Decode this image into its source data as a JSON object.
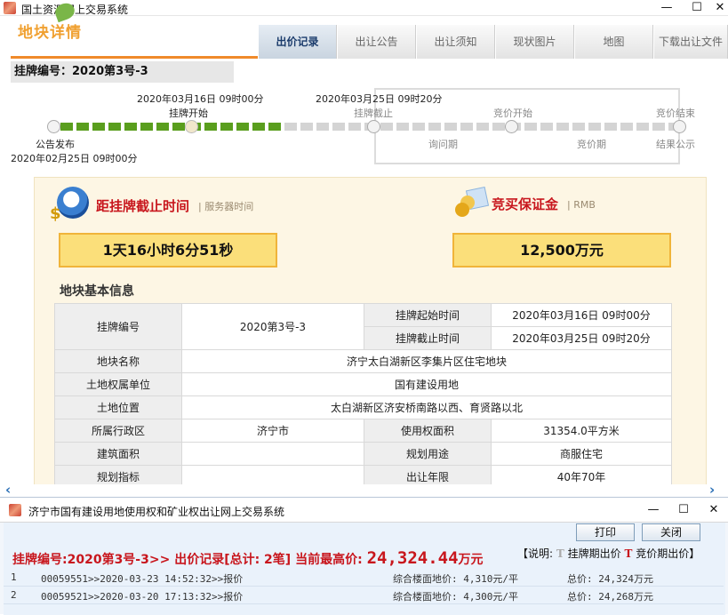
{
  "window": {
    "title": "国土资源网上交易系统",
    "min": "—",
    "max": "☐",
    "close": "✕"
  },
  "header": {
    "logo": "地块详情",
    "tabs": [
      {
        "label": "出价记录",
        "active": true
      },
      {
        "label": "出让公告",
        "active": false
      },
      {
        "label": "出让须知",
        "active": false
      },
      {
        "label": "现状图片",
        "active": false
      },
      {
        "label": "地图",
        "active": false
      },
      {
        "label": "下载出让文件",
        "active": false
      }
    ]
  },
  "lot": {
    "title": "挂牌编号：2020第3号-3"
  },
  "timeline": {
    "announce_label": "公告发布",
    "announce_time": "2020年02月25日  09时00分",
    "listing_start_time": "2020年03月16日  09时00分",
    "listing_start_label": "挂牌开始",
    "listing_end_time": "2020年03月25日  09时20分",
    "listing_end_label": "挂牌截止",
    "inquiry_label": "询问期",
    "bid_start_label": "竞价开始",
    "bid_period_label": "竞价期",
    "bid_end_label": "竞价结束",
    "result_label": "结果公示",
    "colors": {
      "done": "#5a9e1e",
      "pending": "#d4d4d4"
    }
  },
  "deadline": {
    "title": "距挂牌截止时间",
    "sub": "服务器时间",
    "value": "1天16小时6分51秒",
    "icon": "clock-icon"
  },
  "deposit": {
    "title": "竞买保证金",
    "sub": "RMB",
    "value": "12,500万元",
    "icon": "money-icon"
  },
  "info": {
    "title": "地块基本信息",
    "lot_no_label": "挂牌编号",
    "lot_no_value": "2020第3号-3",
    "start_label": "挂牌起始时间",
    "start_value": "2020年03月16日  09时00分",
    "end_label": "挂牌截止时间",
    "end_value": "2020年03月25日  09时20分",
    "name_label": "地块名称",
    "name_value": "济宁太白湖新区李集片区住宅地块",
    "owner_label": "土地权属单位",
    "owner_value": "国有建设用地",
    "location_label": "土地位置",
    "location_value": "太白湖新区济安桥南路以西、育贤路以北",
    "district_label": "所属行政区",
    "district_value": "济宁市",
    "area_label": "使用权面积",
    "area_value": "31354.0平方米",
    "build_label": "建筑面积",
    "build_value": "",
    "use_label": "规划用途",
    "use_value": "商服住宅",
    "plan_label": "规划指标",
    "plan_value": "",
    "years_label": "出让年限",
    "years_value": "40年70年"
  },
  "popup": {
    "title": "济宁市国有建设用地使用权和矿业权出让网上交易系统",
    "print": "打印",
    "close": "关闭",
    "head_prefix": "挂牌编号:2020第3号-3>> 出价记录[总计: 2笔] 当前最高价:",
    "head_price": "24,324.44",
    "head_unit": "万元",
    "legend_prefix": "【说明:",
    "legend_t1": "T",
    "legend_label1": "挂牌期出价",
    "legend_t2": "T",
    "legend_label2": "竞价期出价】",
    "bids": [
      {
        "no": "1",
        "record": "00059551>>2020-03-23 14:52:32>>报价",
        "unit_price": "综合楼面地价: 4,310元/平",
        "total": "总价: 24,324万元"
      },
      {
        "no": "2",
        "record": "00059521>>2020-03-20 17:13:32>>报价",
        "unit_price": "综合楼面地价: 4,300元/平",
        "total": "总价: 24,268万元"
      }
    ]
  }
}
